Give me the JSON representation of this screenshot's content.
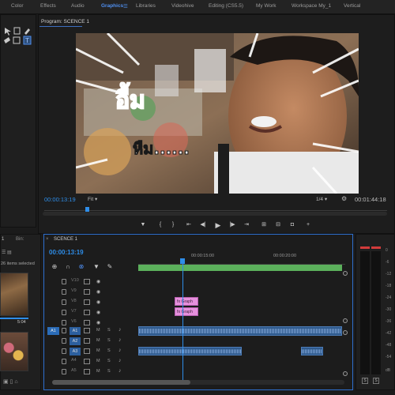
{
  "workspace_tabs": [
    "Color",
    "Effects",
    "Audio",
    "Graphics",
    "Libraries",
    "Videohive",
    "Editing (CS5.5)",
    "My Work",
    "Workspace My_1",
    "Vertical"
  ],
  "active_tab": "Graphics",
  "workspace_menu_glyph": "☰",
  "program_monitor": {
    "title": "Program: SCENCE 1",
    "timecode_current": "00:00:13:19",
    "fit": "Fit",
    "resolution": "1/4",
    "timecode_duration": "00:01:44:18"
  },
  "video": {
    "caption_line1": "อื้ม",
    "caption_line2": "หืม......"
  },
  "transport_icons": [
    "marker-icon",
    "in-point-icon",
    "out-point-icon",
    "go-to-in-icon",
    "step-back-icon",
    "play-icon",
    "step-forward-icon",
    "go-to-out-icon",
    "insert-icon",
    "overwrite-icon",
    "camera-icon",
    "add-button-icon"
  ],
  "project_panel": {
    "tab_project": "1",
    "tab_bin": "Bin:",
    "items_selected": "26 items selected",
    "clip1_duration": "5:04"
  },
  "timeline": {
    "sequence_name": "SCENCE 1",
    "close_glyph": "×",
    "timecode": "00:00:13:19",
    "ruler_label_1": "00:00:15:00",
    "ruler_label_2": "00:00:20:00",
    "video_tracks": [
      "V10",
      "V9",
      "V8",
      "V7",
      "V6"
    ],
    "audio_tracks": [
      "A1",
      "A2",
      "A3",
      "A4",
      "A5"
    ],
    "source_patch_video": "",
    "source_patch_audio": "A1",
    "graphic_clip_label": "Graph",
    "mute_label": "M",
    "solo_label": "S"
  },
  "meters": {
    "db_labels": [
      "0",
      "-6",
      "-12",
      "-18",
      "-24",
      "-30",
      "-36",
      "-42",
      "-48",
      "-54",
      "dB"
    ],
    "solo_labels": [
      "S",
      "S"
    ]
  },
  "colors": {
    "accent_blue": "#2e8de8",
    "graphic_clip": "#e690dd",
    "work_area": "#5bb05b",
    "audio_clip": "#2f5a8d"
  }
}
